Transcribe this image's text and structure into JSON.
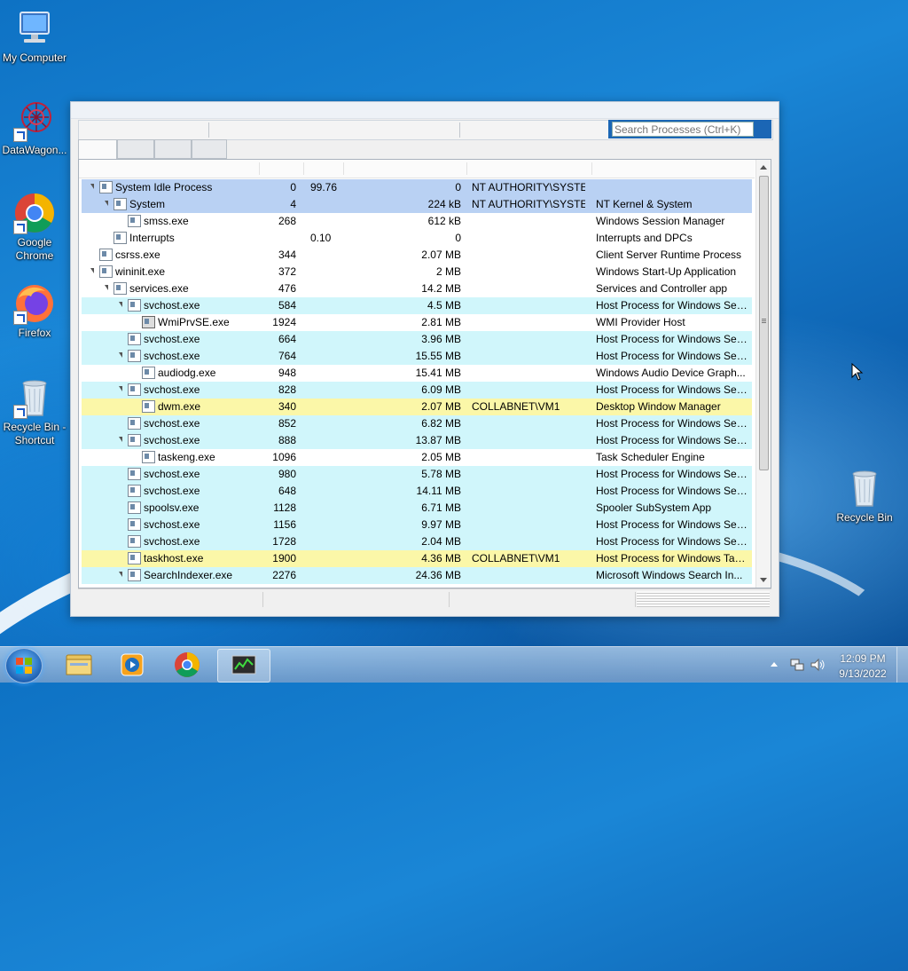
{
  "desktop": {
    "icons": [
      {
        "label": "My Computer"
      },
      {
        "label": "DataWagon..."
      },
      {
        "label": "Google Chrome"
      },
      {
        "label": "Firefox"
      },
      {
        "label": "Recycle Bin - Shortcut"
      },
      {
        "label": "Recycle Bin"
      }
    ]
  },
  "window": {
    "search_placeholder": "Search Processes (Ctrl+K)",
    "processes": [
      {
        "name": "System Idle Process",
        "pid": "0",
        "cpu": "99.76",
        "mem": "0",
        "user": "NT AUTHORITY\\SYSTEM",
        "desc": "",
        "level": 0,
        "expand": true,
        "color": "#b9d1f3"
      },
      {
        "name": "System",
        "pid": "4",
        "cpu": "",
        "mem": "224 kB",
        "user": "NT AUTHORITY\\SYSTEM",
        "desc": "NT Kernel & System",
        "level": 1,
        "expand": true,
        "color": "#b9d1f3"
      },
      {
        "name": "smss.exe",
        "pid": "268",
        "cpu": "",
        "mem": "612 kB",
        "user": "",
        "desc": "Windows Session Manager",
        "level": 2,
        "expand": false,
        "color": "#ffffff"
      },
      {
        "name": "Interrupts",
        "pid": "",
        "cpu": "0.10",
        "mem": "0",
        "user": "",
        "desc": "Interrupts and DPCs",
        "level": 1,
        "expand": false,
        "color": "#ffffff"
      },
      {
        "name": "csrss.exe",
        "pid": "344",
        "cpu": "",
        "mem": "2.07 MB",
        "user": "",
        "desc": "Client Server Runtime Process",
        "level": 0,
        "expand": false,
        "color": "#ffffff"
      },
      {
        "name": "wininit.exe",
        "pid": "372",
        "cpu": "",
        "mem": "2 MB",
        "user": "",
        "desc": "Windows Start-Up Application",
        "level": 0,
        "expand": true,
        "color": "#ffffff"
      },
      {
        "name": "services.exe",
        "pid": "476",
        "cpu": "",
        "mem": "14.2 MB",
        "user": "",
        "desc": "Services and Controller app",
        "level": 1,
        "expand": true,
        "color": "#ffffff"
      },
      {
        "name": "svchost.exe",
        "pid": "584",
        "cpu": "",
        "mem": "4.5 MB",
        "user": "",
        "desc": "Host Process for Windows Ser...",
        "level": 2,
        "expand": true,
        "color": "#d0f6fb"
      },
      {
        "name": "WmiPrvSE.exe",
        "pid": "1924",
        "cpu": "",
        "mem": "2.81 MB",
        "user": "",
        "desc": "WMI Provider Host",
        "level": 3,
        "expand": false,
        "color": "#ffffff",
        "gear": true
      },
      {
        "name": "svchost.exe",
        "pid": "664",
        "cpu": "",
        "mem": "3.96 MB",
        "user": "",
        "desc": "Host Process for Windows Ser...",
        "level": 2,
        "expand": false,
        "color": "#d0f6fb"
      },
      {
        "name": "svchost.exe",
        "pid": "764",
        "cpu": "",
        "mem": "15.55 MB",
        "user": "",
        "desc": "Host Process for Windows Ser...",
        "level": 2,
        "expand": true,
        "color": "#d0f6fb"
      },
      {
        "name": "audiodg.exe",
        "pid": "948",
        "cpu": "",
        "mem": "15.41 MB",
        "user": "",
        "desc": "Windows Audio Device Graph...",
        "level": 3,
        "expand": false,
        "color": "#ffffff"
      },
      {
        "name": "svchost.exe",
        "pid": "828",
        "cpu": "",
        "mem": "6.09 MB",
        "user": "",
        "desc": "Host Process for Windows Ser...",
        "level": 2,
        "expand": true,
        "color": "#d0f6fb"
      },
      {
        "name": "dwm.exe",
        "pid": "340",
        "cpu": "",
        "mem": "2.07 MB",
        "user": "COLLABNET\\VM1",
        "desc": "Desktop Window Manager",
        "level": 3,
        "expand": false,
        "color": "#fbf7a8"
      },
      {
        "name": "svchost.exe",
        "pid": "852",
        "cpu": "",
        "mem": "6.82 MB",
        "user": "",
        "desc": "Host Process for Windows Ser...",
        "level": 2,
        "expand": false,
        "color": "#d0f6fb"
      },
      {
        "name": "svchost.exe",
        "pid": "888",
        "cpu": "",
        "mem": "13.87 MB",
        "user": "",
        "desc": "Host Process for Windows Ser...",
        "level": 2,
        "expand": true,
        "color": "#d0f6fb"
      },
      {
        "name": "taskeng.exe",
        "pid": "1096",
        "cpu": "",
        "mem": "2.05 MB",
        "user": "",
        "desc": "Task Scheduler Engine",
        "level": 3,
        "expand": false,
        "color": "#ffffff"
      },
      {
        "name": "svchost.exe",
        "pid": "980",
        "cpu": "",
        "mem": "5.78 MB",
        "user": "",
        "desc": "Host Process for Windows Ser...",
        "level": 2,
        "expand": false,
        "color": "#d0f6fb"
      },
      {
        "name": "svchost.exe",
        "pid": "648",
        "cpu": "",
        "mem": "14.11 MB",
        "user": "",
        "desc": "Host Process for Windows Ser...",
        "level": 2,
        "expand": false,
        "color": "#d0f6fb"
      },
      {
        "name": "spoolsv.exe",
        "pid": "1128",
        "cpu": "",
        "mem": "6.71 MB",
        "user": "",
        "desc": "Spooler SubSystem App",
        "level": 2,
        "expand": false,
        "color": "#d0f6fb"
      },
      {
        "name": "svchost.exe",
        "pid": "1156",
        "cpu": "",
        "mem": "9.97 MB",
        "user": "",
        "desc": "Host Process for Windows Ser...",
        "level": 2,
        "expand": false,
        "color": "#d0f6fb"
      },
      {
        "name": "svchost.exe",
        "pid": "1728",
        "cpu": "",
        "mem": "2.04 MB",
        "user": "",
        "desc": "Host Process for Windows Ser...",
        "level": 2,
        "expand": false,
        "color": "#d0f6fb"
      },
      {
        "name": "taskhost.exe",
        "pid": "1900",
        "cpu": "",
        "mem": "4.36 MB",
        "user": "COLLABNET\\VM1",
        "desc": "Host Process for Windows Tas...",
        "level": 2,
        "expand": false,
        "color": "#fbf7a8"
      },
      {
        "name": "SearchIndexer.exe",
        "pid": "2276",
        "cpu": "",
        "mem": "24.36 MB",
        "user": "",
        "desc": "Microsoft Windows Search In...",
        "level": 2,
        "expand": true,
        "color": "#d0f6fb"
      }
    ]
  },
  "taskbar": {
    "apps": [
      "windows-explorer",
      "media-player",
      "google-chrome",
      "process-hacker"
    ],
    "time": "12:09 PM",
    "date": "9/13/2022"
  }
}
